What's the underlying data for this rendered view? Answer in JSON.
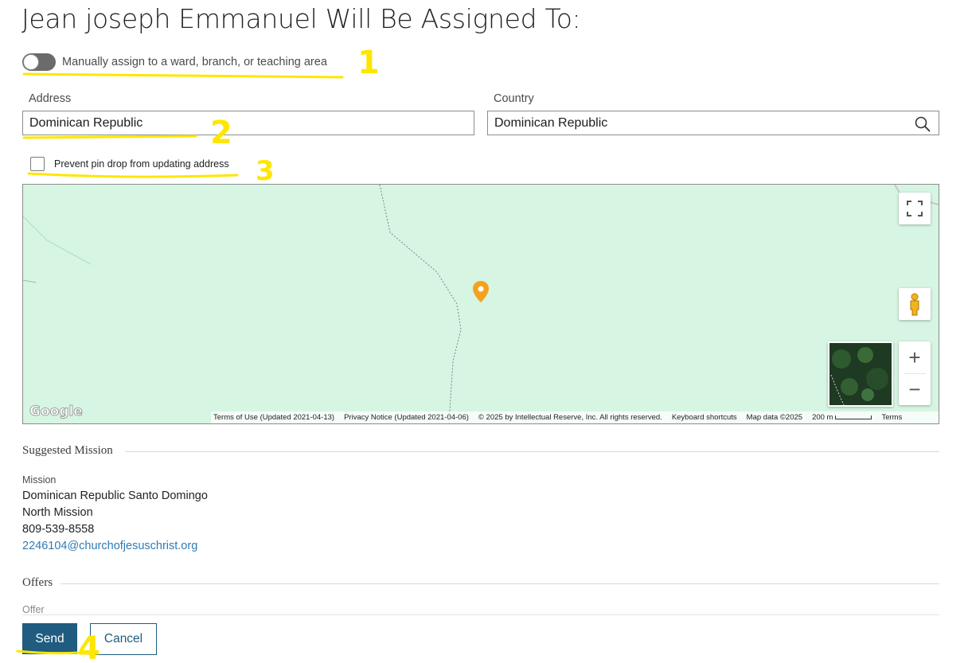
{
  "page": {
    "title": "Jean joseph Emmanuel Will Be Assigned To:"
  },
  "assignment": {
    "manual_toggle_label": "Manually assign to a ward, branch, or teaching area",
    "manual_toggle_on": false
  },
  "address": {
    "label": "Address",
    "value": "Dominican Republic"
  },
  "country": {
    "label": "Country",
    "value": "Dominican Republic"
  },
  "pin_option": {
    "label": "Prevent pin drop from updating address",
    "checked": false
  },
  "map": {
    "google_logo": "Google",
    "footer": [
      "Terms of Use (Updated 2021-04-13)",
      "Privacy Notice (Updated 2021-04-06)",
      "© 2025 by Intellectual Reserve, Inc. All rights reserved.",
      "Keyboard shortcuts",
      "Map data ©2025",
      "200 m",
      "Terms"
    ],
    "zoom_in": "+",
    "zoom_out": "−",
    "marker_color": "#f4a11e",
    "land_color": "#d6f5e3"
  },
  "suggested_mission": {
    "heading": "Suggested Mission",
    "label": "Mission",
    "name_line1": "Dominican Republic Santo Domingo",
    "name_line2": "North Mission",
    "phone": "809-539-8558",
    "email": "2246104@churchofjesuschrist.org"
  },
  "offers": {
    "heading": "Offers",
    "label": "Offer"
  },
  "actions": {
    "send": "Send",
    "cancel": "Cancel",
    "primary_color": "#1f5c7f"
  },
  "annotations": {
    "marks": [
      "1",
      "2",
      "3",
      "4"
    ],
    "color": "#ffe600"
  }
}
